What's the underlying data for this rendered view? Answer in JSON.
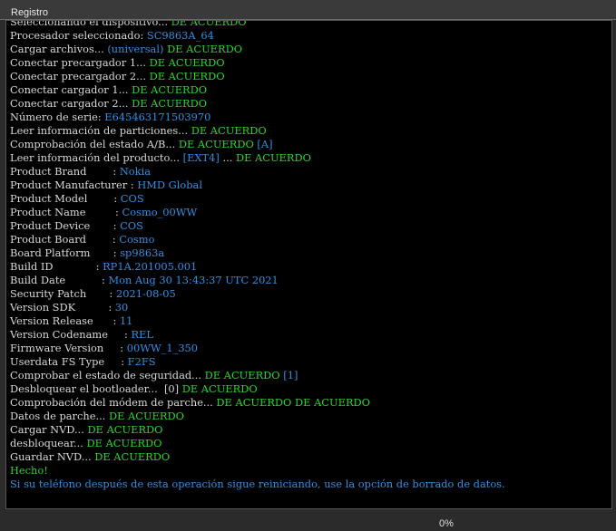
{
  "tab": {
    "label": "Registro"
  },
  "progress": {
    "value_percent": 0,
    "label": "0%"
  },
  "colors": {
    "white": "#d8d8d8",
    "blue": "#2f8fe0",
    "green": "#2bd52b"
  },
  "log": {
    "lines": [
      [
        {
          "t": "Seleccionando el dispositivo... ",
          "c": "w"
        },
        {
          "t": "DE ACUERDO",
          "c": "g"
        }
      ],
      [
        {
          "t": "Procesador seleccionado: ",
          "c": "w"
        },
        {
          "t": "SC9863A_64",
          "c": "b"
        }
      ],
      [
        {
          "t": "Cargar archivos... ",
          "c": "w"
        },
        {
          "t": "(universal) ",
          "c": "b"
        },
        {
          "t": "DE ACUERDO",
          "c": "g"
        }
      ],
      [
        {
          "t": "Conectar precargador 1... ",
          "c": "w"
        },
        {
          "t": "DE ACUERDO",
          "c": "g"
        }
      ],
      [
        {
          "t": "Conectar precargador 2... ",
          "c": "w"
        },
        {
          "t": "DE ACUERDO",
          "c": "g"
        }
      ],
      [
        {
          "t": "Conectar cargador 1... ",
          "c": "w"
        },
        {
          "t": "DE ACUERDO",
          "c": "g"
        }
      ],
      [
        {
          "t": "Conectar cargador 2... ",
          "c": "w"
        },
        {
          "t": "DE ACUERDO",
          "c": "g"
        }
      ],
      [
        {
          "t": "Número de serie: ",
          "c": "w"
        },
        {
          "t": "E645463171503970",
          "c": "b"
        }
      ],
      [
        {
          "t": "Leer información de particiones... ",
          "c": "w"
        },
        {
          "t": "DE ACUERDO",
          "c": "g"
        }
      ],
      [
        {
          "t": "Comprobación del estado A/B... ",
          "c": "w"
        },
        {
          "t": "DE ACUERDO ",
          "c": "g"
        },
        {
          "t": "[A]",
          "c": "b"
        }
      ],
      [
        {
          "t": "Leer información del producto... ",
          "c": "w"
        },
        {
          "t": "[EXT4]",
          "c": "b"
        },
        {
          "t": " ... ",
          "c": "w"
        },
        {
          "t": "DE ACUERDO",
          "c": "g"
        }
      ],
      [
        {
          "t": "Product Brand        : ",
          "c": "w"
        },
        {
          "t": "Nokia",
          "c": "b"
        }
      ],
      [
        {
          "t": "Product Manufacturer : ",
          "c": "w"
        },
        {
          "t": "HMD Global",
          "c": "b"
        }
      ],
      [
        {
          "t": "Product Model        : ",
          "c": "w"
        },
        {
          "t": "COS",
          "c": "b"
        }
      ],
      [
        {
          "t": "Product Name         : ",
          "c": "w"
        },
        {
          "t": "Cosmo_00WW",
          "c": "b"
        }
      ],
      [
        {
          "t": "Product Device       : ",
          "c": "w"
        },
        {
          "t": "COS",
          "c": "b"
        }
      ],
      [
        {
          "t": "Product Board        : ",
          "c": "w"
        },
        {
          "t": "Cosmo",
          "c": "b"
        }
      ],
      [
        {
          "t": "Board Platform       : ",
          "c": "w"
        },
        {
          "t": "sp9863a",
          "c": "b"
        }
      ],
      [
        {
          "t": "Build ID             : ",
          "c": "w"
        },
        {
          "t": "RP1A.201005.001",
          "c": "b"
        }
      ],
      [
        {
          "t": "Build Date           : ",
          "c": "w"
        },
        {
          "t": "Mon Aug 30 13:43:37 UTC 2021",
          "c": "b"
        }
      ],
      [
        {
          "t": "Security Patch       : ",
          "c": "w"
        },
        {
          "t": "2021-08-05",
          "c": "b"
        }
      ],
      [
        {
          "t": "Version SDK          : ",
          "c": "w"
        },
        {
          "t": "30",
          "c": "b"
        }
      ],
      [
        {
          "t": "Version Release      : ",
          "c": "w"
        },
        {
          "t": "11",
          "c": "b"
        }
      ],
      [
        {
          "t": "Version Codename     : ",
          "c": "w"
        },
        {
          "t": "REL",
          "c": "b"
        }
      ],
      [
        {
          "t": "Firmware Version     : ",
          "c": "w"
        },
        {
          "t": "00WW_1_350",
          "c": "b"
        }
      ],
      [
        {
          "t": "Userdata FS Type     : ",
          "c": "w"
        },
        {
          "t": "F2FS",
          "c": "b"
        }
      ],
      [
        {
          "t": "Comprobar el estado de seguridad... ",
          "c": "w"
        },
        {
          "t": "DE ACUERDO ",
          "c": "g"
        },
        {
          "t": "[1]",
          "c": "b"
        }
      ],
      [
        {
          "t": "Desbloquear el bootloader...  [0] ",
          "c": "w"
        },
        {
          "t": "DE ACUERDO",
          "c": "g"
        }
      ],
      [
        {
          "t": "Comprobación del módem de parche... ",
          "c": "w"
        },
        {
          "t": "DE ACUERDO DE ACUERDO",
          "c": "g"
        }
      ],
      [
        {
          "t": "Datos de parche... ",
          "c": "w"
        },
        {
          "t": "DE ACUERDO",
          "c": "g"
        }
      ],
      [
        {
          "t": "Cargar NVD... ",
          "c": "w"
        },
        {
          "t": "DE ACUERDO",
          "c": "g"
        }
      ],
      [
        {
          "t": "desbloquear... ",
          "c": "w"
        },
        {
          "t": "DE ACUERDO",
          "c": "g"
        }
      ],
      [
        {
          "t": "Guardar NVD... ",
          "c": "w"
        },
        {
          "t": "DE ACUERDO",
          "c": "g"
        }
      ],
      [
        {
          "t": "Hecho!",
          "c": "g"
        }
      ],
      [
        {
          "t": "Si su teléfono después de esta operación sigue reiniciando, use la opción de borrado de datos.",
          "c": "b"
        }
      ]
    ]
  }
}
